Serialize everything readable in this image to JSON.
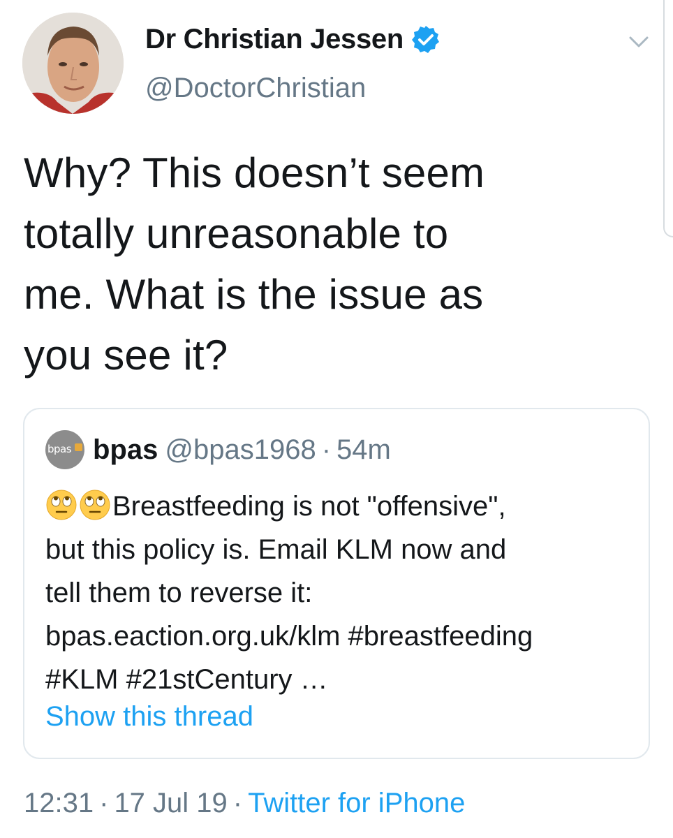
{
  "author": {
    "display_name": "Dr Christian Jessen",
    "handle": "@DoctorChristian",
    "verified": true,
    "avatar_icon": "profile-photo"
  },
  "tweet": {
    "text_lines": [
      "Why? This doesn’t seem",
      "totally unreasonable to",
      "me. What is the issue as",
      "you see it?"
    ]
  },
  "quoted_tweet": {
    "avatar_text": "bpas",
    "name": "bpas",
    "handle": "@bpas1968",
    "separator": "·",
    "time": "54m",
    "emoji": [
      "rolling-eyes-emoji",
      "rolling-eyes-emoji"
    ],
    "body_lines": [
      "Breastfeeding is not \"offensive\",",
      "but this policy is. Email KLM now and",
      "tell them to reverse it:",
      "bpas.eaction.org.uk/klm #breastfeeding",
      "#KLM #21stCentury …"
    ],
    "show_thread": "Show this thread"
  },
  "meta": {
    "time": "12:31",
    "date": "17 Jul 19",
    "separator": "·",
    "source": "Twitter for iPhone"
  },
  "colors": {
    "link": "#1da1f2",
    "secondary_text": "#657786",
    "primary_text": "#14171a",
    "border": "#e1e8ed"
  }
}
